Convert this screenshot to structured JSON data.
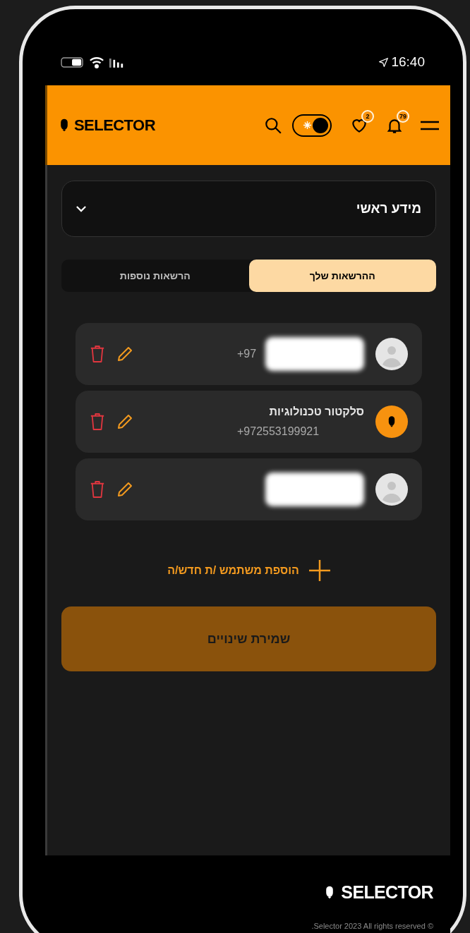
{
  "status_bar": {
    "time": "16:40"
  },
  "header": {
    "logo": "SELECTOR",
    "dark_mode": true,
    "badges": [
      {
        "kind": "bell",
        "count": "79"
      },
      {
        "kind": "heart",
        "count": "2"
      }
    ]
  },
  "section": {
    "title": "מידע ראשי",
    "expanded": false
  },
  "tabs": [
    {
      "label": "ההרשאות שלך",
      "selected": true
    },
    {
      "label": "הרשאות נוספות",
      "selected": false
    }
  ],
  "users": [
    {
      "kind": "generic",
      "phone": "+97",
      "redacted": true
    },
    {
      "kind": "logo",
      "name": "סלקטור טכנולוגיות",
      "phone": "+972553199921",
      "redacted": false
    },
    {
      "kind": "generic",
      "redacted": true
    }
  ],
  "add_user": "הוספת משתמש /ת חדש/ה",
  "save_button": "שמירת שינויים",
  "footer": {
    "logo": "SELECTOR",
    "copyright": ".Selector 2023 All rights reserved ©"
  }
}
